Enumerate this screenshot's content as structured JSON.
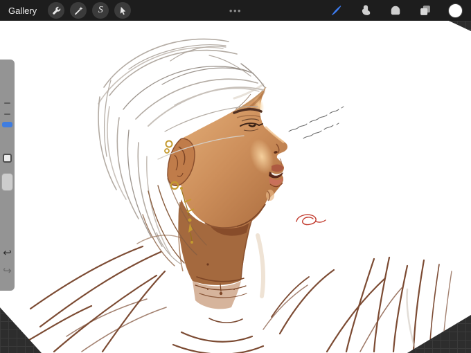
{
  "topbar": {
    "gallery_label": "Gallery",
    "overflow_dots": "•••",
    "left_tools": [
      {
        "id": "actions",
        "icon": "wrench-icon"
      },
      {
        "id": "adjustments",
        "icon": "magic-wand-icon"
      },
      {
        "id": "selection",
        "icon": "selection-s-icon",
        "glyph": "S"
      },
      {
        "id": "transform",
        "icon": "transform-arrow-icon"
      }
    ],
    "right_tools": [
      {
        "id": "paint",
        "icon": "brush-icon",
        "active": true,
        "color": "#3d7ef5"
      },
      {
        "id": "smudge",
        "icon": "smudge-icon"
      },
      {
        "id": "erase",
        "icon": "eraser-icon"
      },
      {
        "id": "layers",
        "icon": "layers-icon"
      },
      {
        "id": "color",
        "icon": "color-swatch",
        "value": "#ffffff"
      }
    ]
  },
  "sidebar": {
    "undo_glyph": "↩",
    "redo_glyph": "↪",
    "brush_size_accent": "#3f7de0"
  },
  "canvas": {
    "background": "#ffffff",
    "artwork": "profile portrait sketch — white hair, bronze skin, gold earrings, white jacket line art",
    "signature_color": "#c23b2e",
    "skin_tones": [
      "#edbe8a",
      "#b3764a",
      "#7f4526"
    ],
    "gold_color": "#c49a2f"
  }
}
